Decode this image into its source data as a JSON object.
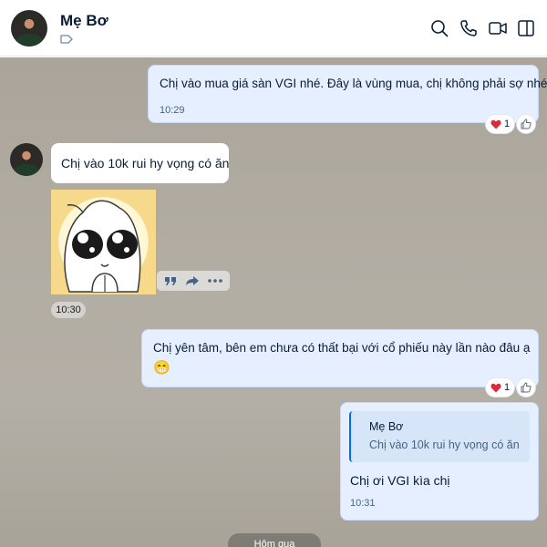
{
  "header": {
    "contact_name": "Mẹ Bơ"
  },
  "messages": {
    "m1": {
      "text": "Chị vào mua giá sàn VGI nhé. Đây là vùng mua, chị không phải sợ nhé",
      "time": "10:29",
      "reaction_count": "1"
    },
    "m2": {
      "text": "Chị vào 10k rui hy vọng có ăn"
    },
    "m3": {
      "time": "10:30"
    },
    "m4": {
      "text": "Chị yên tâm, bên em chưa có thất bại với cổ phiếu này lần nào đâu ạ",
      "emoji": "😁",
      "reaction_count": "1"
    },
    "m5": {
      "quote_name": "Mẹ Bơ",
      "quote_text": "Chị vào 10k rui hy vọng có ăn",
      "text": "Chị ơi VGI kìa chị",
      "time": "10:31"
    }
  },
  "day_separator": "Hôm qua",
  "colors": {
    "accent": "#0068ff",
    "my_bubble": "#e5efff",
    "reaction_heart": "#e0283c"
  }
}
